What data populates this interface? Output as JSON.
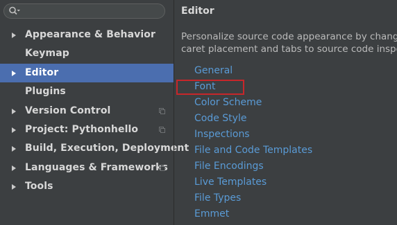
{
  "search": {
    "placeholder": ""
  },
  "sidebar": {
    "items": [
      {
        "label": "Appearance & Behavior",
        "arrow": true,
        "project": false
      },
      {
        "label": "Keymap",
        "arrow": false,
        "project": false
      },
      {
        "label": "Editor",
        "arrow": true,
        "project": false,
        "selected": true
      },
      {
        "label": "Plugins",
        "arrow": false,
        "project": false
      },
      {
        "label": "Version Control",
        "arrow": true,
        "project": true
      },
      {
        "label": "Project: Pythonhello",
        "arrow": true,
        "project": true
      },
      {
        "label": "Build, Execution, Deployment",
        "arrow": true,
        "project": false
      },
      {
        "label": "Languages & Frameworks",
        "arrow": true,
        "project": true
      },
      {
        "label": "Tools",
        "arrow": true,
        "project": false
      }
    ]
  },
  "content": {
    "title": "Editor",
    "description_line1": "Personalize source code appearance by changing fonts, highlighting colors,",
    "description_line2": "caret placement and tabs to source code inspections",
    "links": [
      "General",
      "Font",
      "Color Scheme",
      "Code Style",
      "Inspections",
      "File and Code Templates",
      "File Encodings",
      "Live Templates",
      "File Types",
      "Emmet"
    ]
  },
  "colors": {
    "background": "#3c3f41",
    "selection": "#4b6eaf",
    "link": "#5a9bd6",
    "highlight_box": "#c8262a"
  },
  "icons": {
    "search": "search-icon",
    "expand": "chevron-right-icon",
    "project": "project-level-icon"
  }
}
